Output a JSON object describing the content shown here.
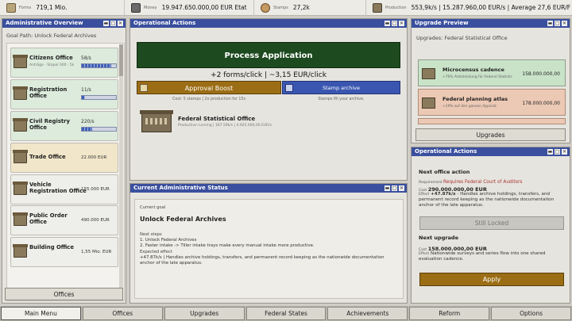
{
  "topbar": {
    "forms": {
      "label": "Forms",
      "value": "719,1 Mio."
    },
    "money": {
      "label": "Money",
      "value": "19.947.650.000,00 EUR Etat"
    },
    "stamps": {
      "label": "Stamps",
      "value": "27,2k"
    },
    "production": {
      "label": "Production",
      "value": "553,9k/s | 15.287.960,00 EUR/s | Average 27,6 EUR/F"
    }
  },
  "admin_overview": {
    "title": "Administrative Overview",
    "goal_path": "Goal Path: Unlock Federal Archives",
    "buildings": [
      {
        "name": "Citizens Office",
        "sub": "Anträge · Stapel 300 · 5k",
        "rate": "58/s",
        "fill": 0.85,
        "bg": "#dcebdc"
      },
      {
        "name": "Registration Office",
        "sub": "",
        "rate": "11/s",
        "fill": 0.1,
        "bg": "#dcebdc"
      },
      {
        "name": "Civil Registry Office",
        "sub": "",
        "rate": "220/s",
        "fill": 0.3,
        "bg": "#dcebdc"
      },
      {
        "name": "Trade Office",
        "sub": "",
        "price": "22.000 EUR",
        "bg": "#f1e6c9"
      },
      {
        "name": "Vehicle Registration Office",
        "sub": "",
        "price": "155.000 EUR",
        "bg": "#eeeeea"
      },
      {
        "name": "Public Order Office",
        "sub": "",
        "price": "490.000 EUR",
        "bg": "#eeeeea"
      },
      {
        "name": "Building Office",
        "sub": "",
        "price": "1,55 Mio. EUR",
        "bg": "#eeeeea"
      }
    ],
    "offices_button": "Offices"
  },
  "operational_actions": {
    "title": "Operational Actions",
    "process_button": "Process Application",
    "rate": "+2 forms/click | ~3,15 EUR/click",
    "boost_button": "Approval Boost",
    "boost_caption": "Cost: 5 stamps | 2x production for 15s",
    "stamp_button": "Stamp archive",
    "stamp_caption": "Stamps fill your archive.",
    "featured_name": "Federal Statistical Office",
    "featured_desc": "Productive running | 167.59k/s | 4.925.000,00 EUR/s"
  },
  "status": {
    "title": "Current Administrative Status",
    "current_goal_label": "Current goal",
    "current_goal": "Unlock Federal Archives",
    "next_steps_label": "Next steps",
    "step1": "1. Unlock Federal Archives",
    "step2": "2. Faster intake -> Tiller intake trays make every manual intake more productive.",
    "expected_label": "Expected effect",
    "expected": "+47.87k/s | Handles archive holdings, transfers, and permanent record keeping as the nationwide documentation anchor of the late apparatus."
  },
  "upgrade_preview": {
    "title": "Upgrade Preview",
    "subtitle": "Upgrades: Federal Statistical Office",
    "items": [
      {
        "name": "Microcensus cadence",
        "desc": "+76% Amtsleistung für Federal Statistic",
        "price": "158.000.000,00",
        "bg": "#c9e3c8"
      },
      {
        "name": "Federal planning atlas",
        "desc": "+19% auf den ganzen Apparat",
        "price": "178.000.000,00",
        "bg": "#ecc9b5"
      }
    ],
    "upgrades_button": "Upgrades"
  },
  "right_actions": {
    "title": "Operational Actions",
    "next_office_label": "Next office action",
    "requirement_label": "Requirement",
    "requirement": "Requires Federal Court of Auditors",
    "cost_label": "Cost",
    "cost": "290.000.000,00 EUR",
    "effect_label": "Effect",
    "effect_value": "+47.87k/s",
    "effect_desc": " - Handles archive holdings, transfers, and permanent record keeping as the nationwide documentation anchor of the late apparatus.",
    "still_locked": "Still Locked",
    "next_upgrade_label": "Next upgrade",
    "upgrade_cost": "158.000.000,00 EUR",
    "upgrade_effect": "Nationwide surveys and series flow into one shared evaluation cadence.",
    "apply_button": "Apply"
  },
  "bottom_nav": [
    "Main Menu",
    "Offices",
    "Upgrades",
    "Federal States",
    "Achievements",
    "Reform",
    "Options"
  ]
}
